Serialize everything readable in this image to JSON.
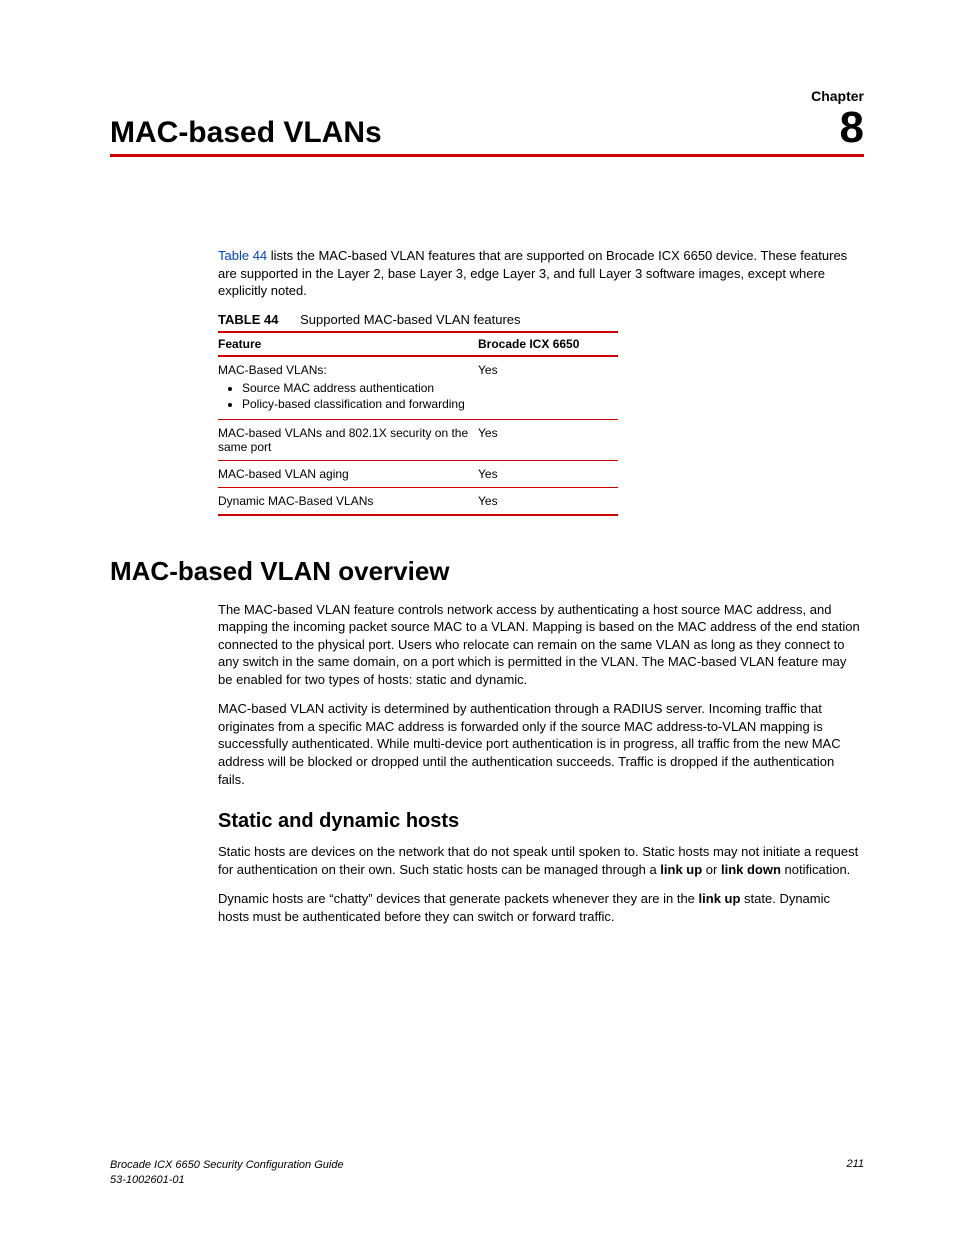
{
  "chapterLabel": "Chapter",
  "chapterNumber": "8",
  "chapterTitle": "MAC-based VLANs",
  "intro": {
    "linkText": "Table 44",
    "rest": " lists the MAC-based VLAN features that are supported on Brocade ICX 6650 device. These features are supported in the Layer 2, base Layer 3, edge Layer 3, and full Layer 3 software images, except where explicitly noted."
  },
  "table": {
    "label": "TABLE 44",
    "caption": "Supported MAC-based VLAN features",
    "headers": [
      "Feature",
      "Brocade ICX 6650"
    ],
    "rows": [
      {
        "feature": "MAC-Based VLANs:",
        "bullets": [
          "Source MAC address authentication",
          "Policy-based classification and forwarding"
        ],
        "value": "Yes"
      },
      {
        "feature": "MAC-based VLANs and 802.1X security on the same port",
        "value": "Yes"
      },
      {
        "feature": "MAC-based VLAN aging",
        "value": "Yes"
      },
      {
        "feature": "Dynamic MAC-Based VLANs",
        "value": "Yes"
      }
    ]
  },
  "overview": {
    "heading": "MAC-based VLAN overview",
    "p1": "The MAC-based VLAN feature controls network access by authenticating a host source MAC address, and mapping the incoming packet source MAC to a VLAN. Mapping is based on the MAC address of the end station connected to the physical port. Users who relocate can remain on the same VLAN as long as they connect to any switch in the same domain, on a port which is permitted in the VLAN. The MAC-based VLAN feature may be enabled for two types of hosts: static and dynamic.",
    "p2": "MAC-based VLAN activity is determined by authentication through a RADIUS server. Incoming traffic that originates from a specific MAC address is forwarded only if the source MAC address-to-VLAN mapping is successfully authenticated. While multi-device port authentication is in progress, all traffic from the new MAC address will be blocked or dropped until the authentication succeeds. Traffic is dropped if the authentication fails."
  },
  "hosts": {
    "heading": "Static and dynamic hosts",
    "p1a": "Static hosts are devices on the network that do not speak until spoken to. Static hosts may not initiate a request for authentication on their own. Such static hosts can be managed through a ",
    "p1b1": "link up",
    "p1c": " or ",
    "p1b2": "link down",
    "p1d": " notification.",
    "p2a": "Dynamic hosts are “chatty” devices that generate packets whenever they are in the ",
    "p2b": "link up",
    "p2c": " state. Dynamic hosts must be authenticated before they can switch or forward traffic."
  },
  "footer": {
    "line1": "Brocade ICX 6650 Security Configuration Guide",
    "line2": "53-1002601-01",
    "page": "211"
  }
}
